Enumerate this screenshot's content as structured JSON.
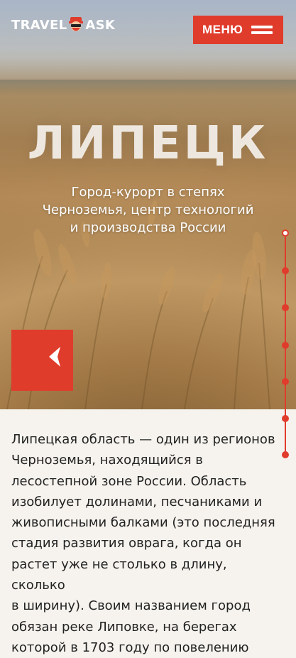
{
  "header": {
    "logo_left": "TRAVEL",
    "logo_right": "ASK",
    "menu_label": "МЕНЮ"
  },
  "hero": {
    "title": "ЛИПЕЦК",
    "subtitle_line1": "Город-курорт в степях",
    "subtitle_line2": "Черноземья, центр технологий",
    "subtitle_line3": "и производства России"
  },
  "controls": {
    "prev_icon": "chevron-left-icon"
  },
  "timeline": {
    "dots": 7,
    "active_index": 0
  },
  "article": {
    "lines": [
      "Липецкая область — один из регионов",
      "Черноземья, находящийся в",
      "лесостепной зоне России. Область",
      "изобилует долинами, песчаниками и",
      "живописными балками (это последняя",
      "стадия развития оврага, когда он",
      "растет уже не столько в длину, сколько",
      "в ширину). Своим названием город",
      "обязан реке Липовке, на берегах",
      "которой в 1703 году по повелению"
    ]
  },
  "colors": {
    "accent": "#e03c2c",
    "text": "#222222",
    "background": "#f6f3ee"
  }
}
